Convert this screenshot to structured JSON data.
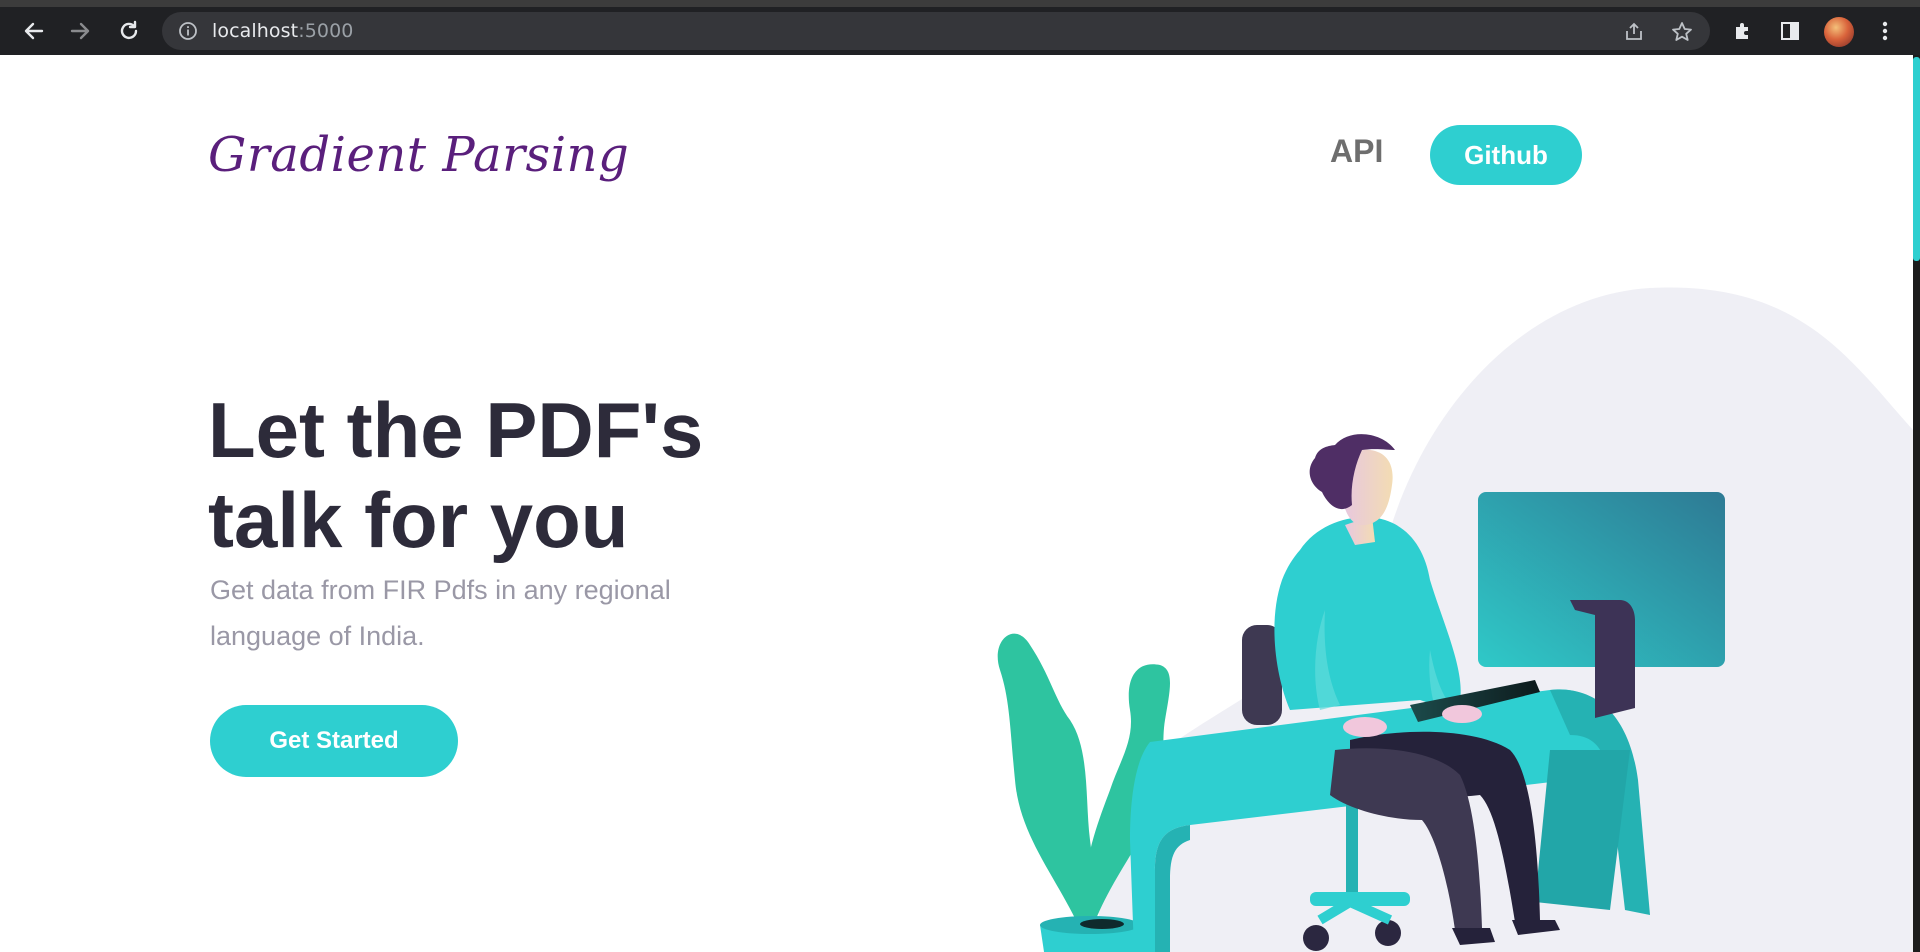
{
  "browser": {
    "url_host": "localhost",
    "url_port": ":5000",
    "icons": [
      "back-arrow-icon",
      "forward-arrow-icon",
      "reload-icon",
      "info-icon",
      "share-icon",
      "bookmark-star-icon",
      "extensions-puzzle-icon",
      "side-panel-icon",
      "profile-avatar",
      "menu-kebab-icon"
    ]
  },
  "header": {
    "logo": "Gradient Parsing",
    "nav": {
      "api_label": "API",
      "github_label": "Github"
    }
  },
  "hero": {
    "title_line1": "Let the PDF's",
    "title_line2": "talk for you",
    "subtitle": "Get data from FIR Pdfs in any regional language of India.",
    "cta_label": "Get Started"
  },
  "colors": {
    "accent": "#2ecfd0",
    "logo": "#5a1f7c",
    "heading": "#2d2b3a",
    "muted": "#9a98a6"
  }
}
